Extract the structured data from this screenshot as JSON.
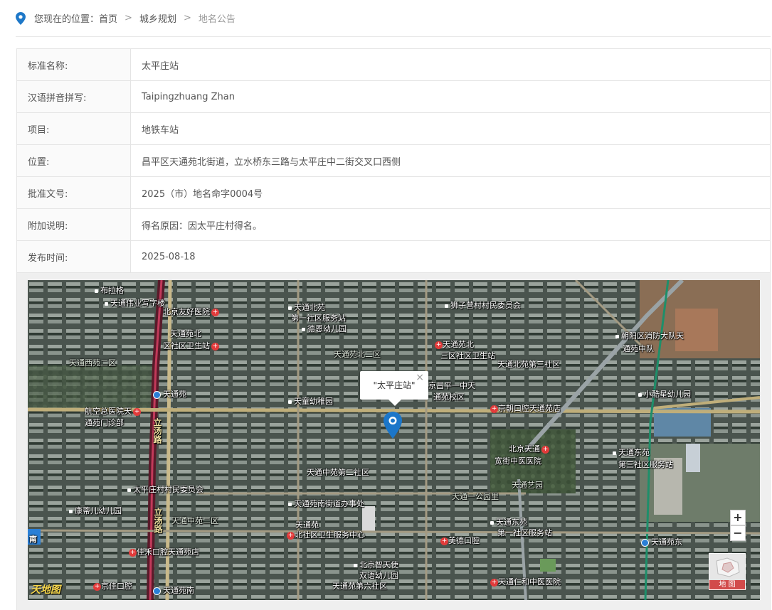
{
  "breadcrumb": {
    "prefix": "您现在的位置：",
    "home": "首页",
    "separator": ">",
    "section": "城乡规划",
    "current": "地名公告"
  },
  "rows": [
    {
      "label": "标准名称:",
      "value": "太平庄站"
    },
    {
      "label": "汉语拼音拼写:",
      "value": "Taipingzhuang Zhan"
    },
    {
      "label": "项目:",
      "value": "地铁车站"
    },
    {
      "label": "位置:",
      "value": "昌平区天通苑北街道，立水桥东三路与太平庄中二街交叉口西侧"
    },
    {
      "label": "批准文号:",
      "value": "2025（市）地名命字0004号"
    },
    {
      "label": "附加说明:",
      "value": "得名原因：因太平庄村得名。"
    },
    {
      "label": "发布时间:",
      "value": "2025-08-18"
    }
  ],
  "map": {
    "popup_text": "\"太平庄站\"",
    "popup_close": "×",
    "zoom_in": "+",
    "zoom_out": "−",
    "maptype_label": "地 图",
    "logo_text": "天地图",
    "labels": {
      "l1": "布拉格",
      "l2": "天通伟业写字楼",
      "l3": "北京友好医院",
      "l4": "天通北苑",
      "l5": "第一社区服务站",
      "l6": "德恩幼儿园",
      "l7": "狮子营村村民委员会",
      "l8": "天通苑北",
      "l9": "区社区卫生站",
      "l10": "天通苑北二区",
      "l11": "天通苑北",
      "l12": "三区社区卫生站",
      "l13": "天通北苑第三社区",
      "l14": "朝阳区消防大队天",
      "l15": "通苑中队",
      "l16": "天通西苑二区",
      "l17": "天通苑",
      "l18": "天童幼稚园",
      "l19": "北京昌平一中天",
      "l20": "通苑校区",
      "l21": "京朝口腔天通苑店",
      "l22": "小酷星幼儿园",
      "l23": "航空总医院天",
      "l24": "通苑门诊部",
      "l25": "立汤路",
      "l26": "北京天通",
      "l27": "宽街中医医院",
      "l28": "天通东苑",
      "l29": "第三社区服务站",
      "l30": "天通中苑第二社区",
      "l31": "太平庄村村民委员会",
      "l32": "天通艺园",
      "l33": "天通一公园里",
      "l34": "天通苑南街道办事处",
      "l35": "康蒂儿幼儿园",
      "l36": "天通中苑二区",
      "l37": "天通苑",
      "l38": "北社区卫生服务中心",
      "l39": "天通东苑",
      "l40": "第一社区服务站",
      "l41": "美德口腔",
      "l42": "天通苑东",
      "l43": "佳禾口腔天通苑店",
      "l44": "北京智天使",
      "l45": "双语幼儿园",
      "l46": "天通苑第六社区",
      "l47": "天通仁和中医医院",
      "l48": "京佳口腔",
      "l49": "天通苑南",
      "l50": "立汤路",
      "l51": "南"
    }
  }
}
